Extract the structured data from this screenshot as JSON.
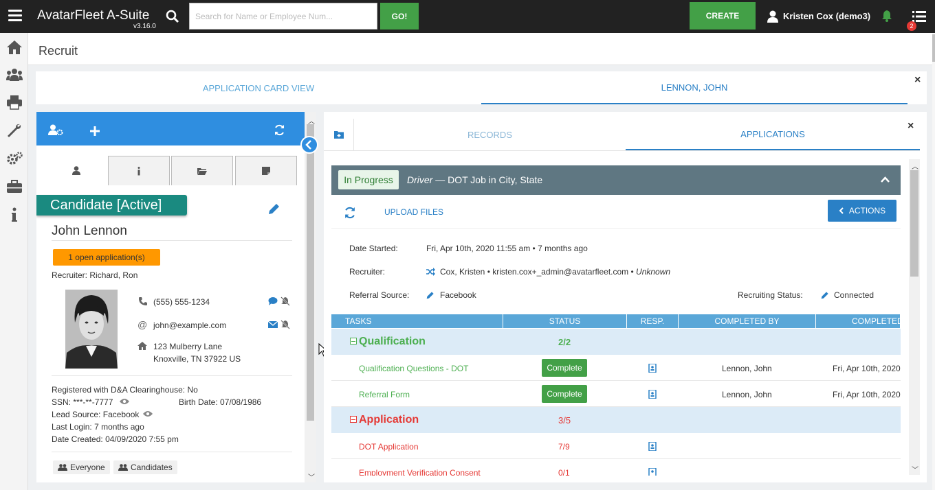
{
  "topbar": {
    "app_title": "AvatarFleet A-Suite",
    "version": "v3.16.0",
    "search_placeholder": "Search for Name or Employee Num...",
    "go_label": "GO!",
    "create_label": "CREATE",
    "user_name": "Kristen Cox (demo3)",
    "notif_count": "2"
  },
  "sidebar": {
    "icons": [
      "home-icon",
      "users-icon",
      "print-icon",
      "wrench-icon",
      "cogs-icon",
      "briefcase-icon",
      "info-icon"
    ]
  },
  "page": {
    "title": "Recruit"
  },
  "outer_tabs": [
    {
      "label": "APPLICATION CARD VIEW"
    },
    {
      "label": "LENNON, JOHN"
    }
  ],
  "candidate": {
    "status_badge": "Candidate [Active]",
    "name": "John Lennon",
    "open_apps": "1 open application(s)",
    "recruiter_label": "Recruiter:",
    "recruiter": "Richard, Ron",
    "phone": "(555) 555-1234",
    "email": "john@example.com",
    "address1": "123 Mulberry Lane",
    "address2": "Knoxville, TN 37922 US",
    "clearinghouse_label": "Registered with D&A Clearinghouse:",
    "clearinghouse": "No",
    "ssn_label": "SSN:",
    "ssn": "***-**-7777",
    "birth_label": "Birth Date:",
    "birth": "07/08/1986",
    "lead_label": "Lead Source:",
    "lead": "Facebook",
    "login_label": "Last Login:",
    "login": "7 months ago",
    "created_label": "Date Created:",
    "created": "04/09/2020 7:55 pm",
    "chips": [
      "Everyone",
      "Candidates"
    ]
  },
  "right_tabs": [
    {
      "label": "RECORDS"
    },
    {
      "label": "APPLICATIONS"
    }
  ],
  "application": {
    "status": "In Progress",
    "role": "Driver",
    "job": " — DOT Job in City, State",
    "upload_label": "UPLOAD FILES",
    "actions_label": "ACTIONS",
    "date_started_label": "Date Started:",
    "date_started": "Fri, Apr 10th, 2020 11:55 am • 7 months ago",
    "recruiter_label": "Recruiter:",
    "recruiter": "Cox, Kristen • kristen.cox+_admin@avatarfleet.com •",
    "recruiter_status": "Unknown",
    "referral_label": "Referral Source:",
    "referral": "Facebook",
    "recruiting_status_label": "Recruiting Status:",
    "recruiting_status": "Connected"
  },
  "table": {
    "headers": [
      "TASKS",
      "STATUS",
      "RESP.",
      "COMPLETED BY",
      "COMPLETED"
    ],
    "groups": [
      {
        "title": "Qualification",
        "count": "2/2",
        "color": "#4caf50",
        "tasks": [
          {
            "name": "Qualification Questions - DOT",
            "status": "Complete",
            "completed_by": "Lennon, John",
            "completed": "Fri, Apr 10th, 2020"
          },
          {
            "name": "Referral Form",
            "status": "Complete",
            "completed_by": "Lennon, John",
            "completed": "Fri, Apr 10th, 2020"
          }
        ]
      },
      {
        "title": "Application",
        "count": "3/5",
        "color": "#e53935",
        "tasks": [
          {
            "name": "DOT Application",
            "status": "7/9",
            "completed_by": "",
            "completed": ""
          },
          {
            "name": "Employment Verification Consent",
            "status": "0/1",
            "completed_by": "",
            "completed": ""
          }
        ]
      }
    ]
  },
  "colors": {
    "topbar": "#222222",
    "accent_blue": "#2a80c6",
    "header_blue": "#2f8ee0",
    "green": "#43a047",
    "teal": "#1a8a80",
    "orange": "#ff9800",
    "slate": "#5f7782"
  }
}
